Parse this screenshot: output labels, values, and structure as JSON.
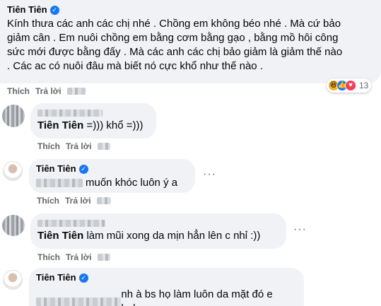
{
  "comments": [
    {
      "author": "Tiên Tiên",
      "lines": [
        "Kính thưa các anh các chị nhé . Chồng em không béo nhé . Mà cứ bảo",
        "giảm cân . Em nuôi chồng em bằng cơm bằng gạo , bằng mồ hôi công",
        "sức mới được bằng đấy . Mà các anh các chị bảo giảm là giảm thế nào",
        ". Các ac có nuôi đâu mà biết nó cực khổ như thế nào ."
      ],
      "reaction_count": "13",
      "reaction_icons": [
        "haha-icon",
        "like-icon",
        "love-icon"
      ],
      "like_label": "Thích",
      "reply_label": "Trả lời"
    },
    {
      "mention": "Tiên Tiên",
      "text": " =))) khổ =)))",
      "like_label": "Thích",
      "reply_label": "Trả lời"
    },
    {
      "author": "Tiên Tiên",
      "text": "muốn khóc luôn ý a",
      "like_label": "Thích",
      "reply_label": "Trả lời",
      "more_label": "···"
    },
    {
      "mention": "Tiên Tiên",
      "text": " làm mũi xong da mịn hẳn lên c nhỉ :))",
      "like_label": "Thích",
      "reply_label": "Trả lời",
      "more_label": "···"
    },
    {
      "author": "Tiên Tiên",
      "text_suffix": "nh à bs họ làm luôn da mặt đó e haha"
    }
  ],
  "colors": {
    "bubble": "#f0f2f5",
    "verified": "#1877f2",
    "muted": "#65676b"
  }
}
